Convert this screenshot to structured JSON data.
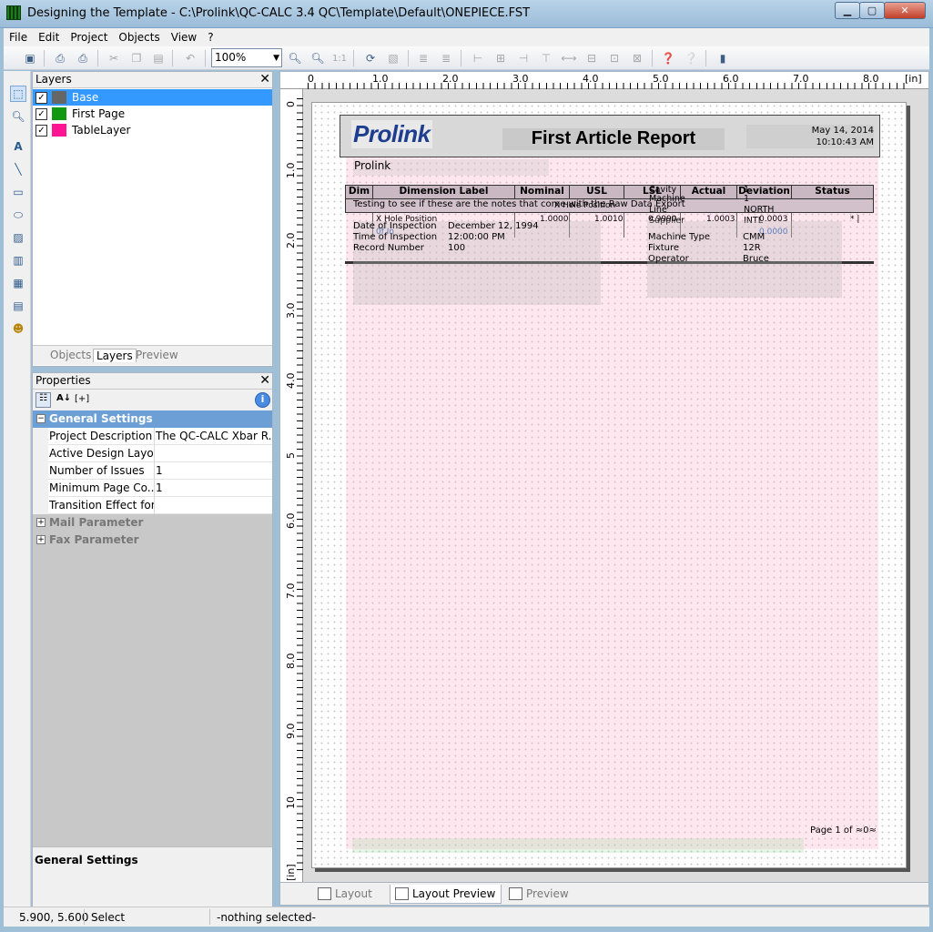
{
  "window": {
    "title": "Designing the Template - C:\\Prolink\\QC-CALC 3.4 QC\\Template\\Default\\ONEPIECE.FST",
    "min": "▁",
    "max": "▢",
    "close": "✕"
  },
  "menu": [
    {
      "label": "File"
    },
    {
      "label": "Edit"
    },
    {
      "label": "Project"
    },
    {
      "label": "Objects"
    },
    {
      "label": "View"
    },
    {
      "label": "?"
    }
  ],
  "toolbar": {
    "zoom_value": "100%",
    "one_to_one": "1:1"
  },
  "layers_panel": {
    "title": "Layers",
    "layers": [
      {
        "name": "Base",
        "color": "#666666",
        "checked": "✓"
      },
      {
        "name": "First Page",
        "color": "#109910",
        "checked": "✓"
      },
      {
        "name": "TableLayer",
        "color": "#ff1493",
        "checked": "✓"
      }
    ],
    "tabs": [
      "Objects",
      "Layers",
      "Preview"
    ]
  },
  "properties_panel": {
    "title": "Properties",
    "sort_label": "[+]",
    "groups": [
      {
        "label": "General Settings",
        "expander": "−"
      },
      {
        "label": "Mail Parameter",
        "expander": "+"
      },
      {
        "label": "Fax Parameter",
        "expander": "+"
      }
    ],
    "rows": [
      {
        "name": "Project Description",
        "value": "The QC-CALC Xbar R..."
      },
      {
        "name": "Active Design Layout",
        "value": ""
      },
      {
        "name": "Number of Issues",
        "value": "1"
      },
      {
        "name": "Minimum Page Co...",
        "value": "1"
      },
      {
        "name": "Transition Effect for...",
        "value": ""
      }
    ],
    "description_title": "General Settings"
  },
  "rulers": {
    "unit": "[in]",
    "unit_v": "[in]",
    "h_labels": [
      "0",
      "1.0",
      "2.0",
      "3.0",
      "4.0",
      "5.0",
      "6.0",
      "7.0",
      "8.0"
    ],
    "v_labels": [
      "0",
      "1.0",
      "2.0",
      "3.0",
      "4.0",
      "5",
      "6.0",
      "7.0",
      "8.0",
      "9.0",
      "10"
    ]
  },
  "report": {
    "logo": "Prolink",
    "title": "First Article Report",
    "date": "May 14, 2014",
    "time": "10:10:43 AM",
    "company": "Prolink",
    "columns": [
      "Dim",
      "Dimension Label",
      "Nominal",
      "USL",
      "LSL",
      "Actual",
      "Deviation",
      "Status"
    ],
    "notes": "Testing to see if these are the notes that come with the Raw Data Export",
    "overlap": {
      "x_hole": "X Hole Position",
      "x_hole2": "X Hole Position",
      "cavity": "Cavity",
      "cavity_v": "1",
      "machine": "Machine",
      "machine_v": "1",
      "line": "Line",
      "line_v": "NORTH",
      "supplier": "Supplier",
      "supplier_v": "INTL",
      "nominal": "1.0000",
      "usl": "1.0010",
      "lsl": "0.9990",
      "actual": "1.0003",
      "deviation": "0.0003",
      "dev2": "0.0000",
      "of_in": "0f In",
      "flag": "* |"
    },
    "info_left": [
      {
        "label": "Date of Inspection",
        "value": "December 12, 1994"
      },
      {
        "label": "Time of Inspection",
        "value": "12:00:00 PM"
      },
      {
        "label": "Record Number",
        "value": "100"
      }
    ],
    "info_right": [
      {
        "label": "Machine Type",
        "value": "CMM"
      },
      {
        "label": "Fixture",
        "value": "12R"
      },
      {
        "label": "Operator",
        "value": "Bruce"
      }
    ],
    "footer": "Page  1  of  ≈0≈"
  },
  "bottom_tabs": [
    "Layout",
    "Layout Preview",
    "Preview"
  ],
  "statusbar": {
    "coords": "5.900, 5.600",
    "mode": "Select",
    "selection": "-nothing selected-"
  }
}
